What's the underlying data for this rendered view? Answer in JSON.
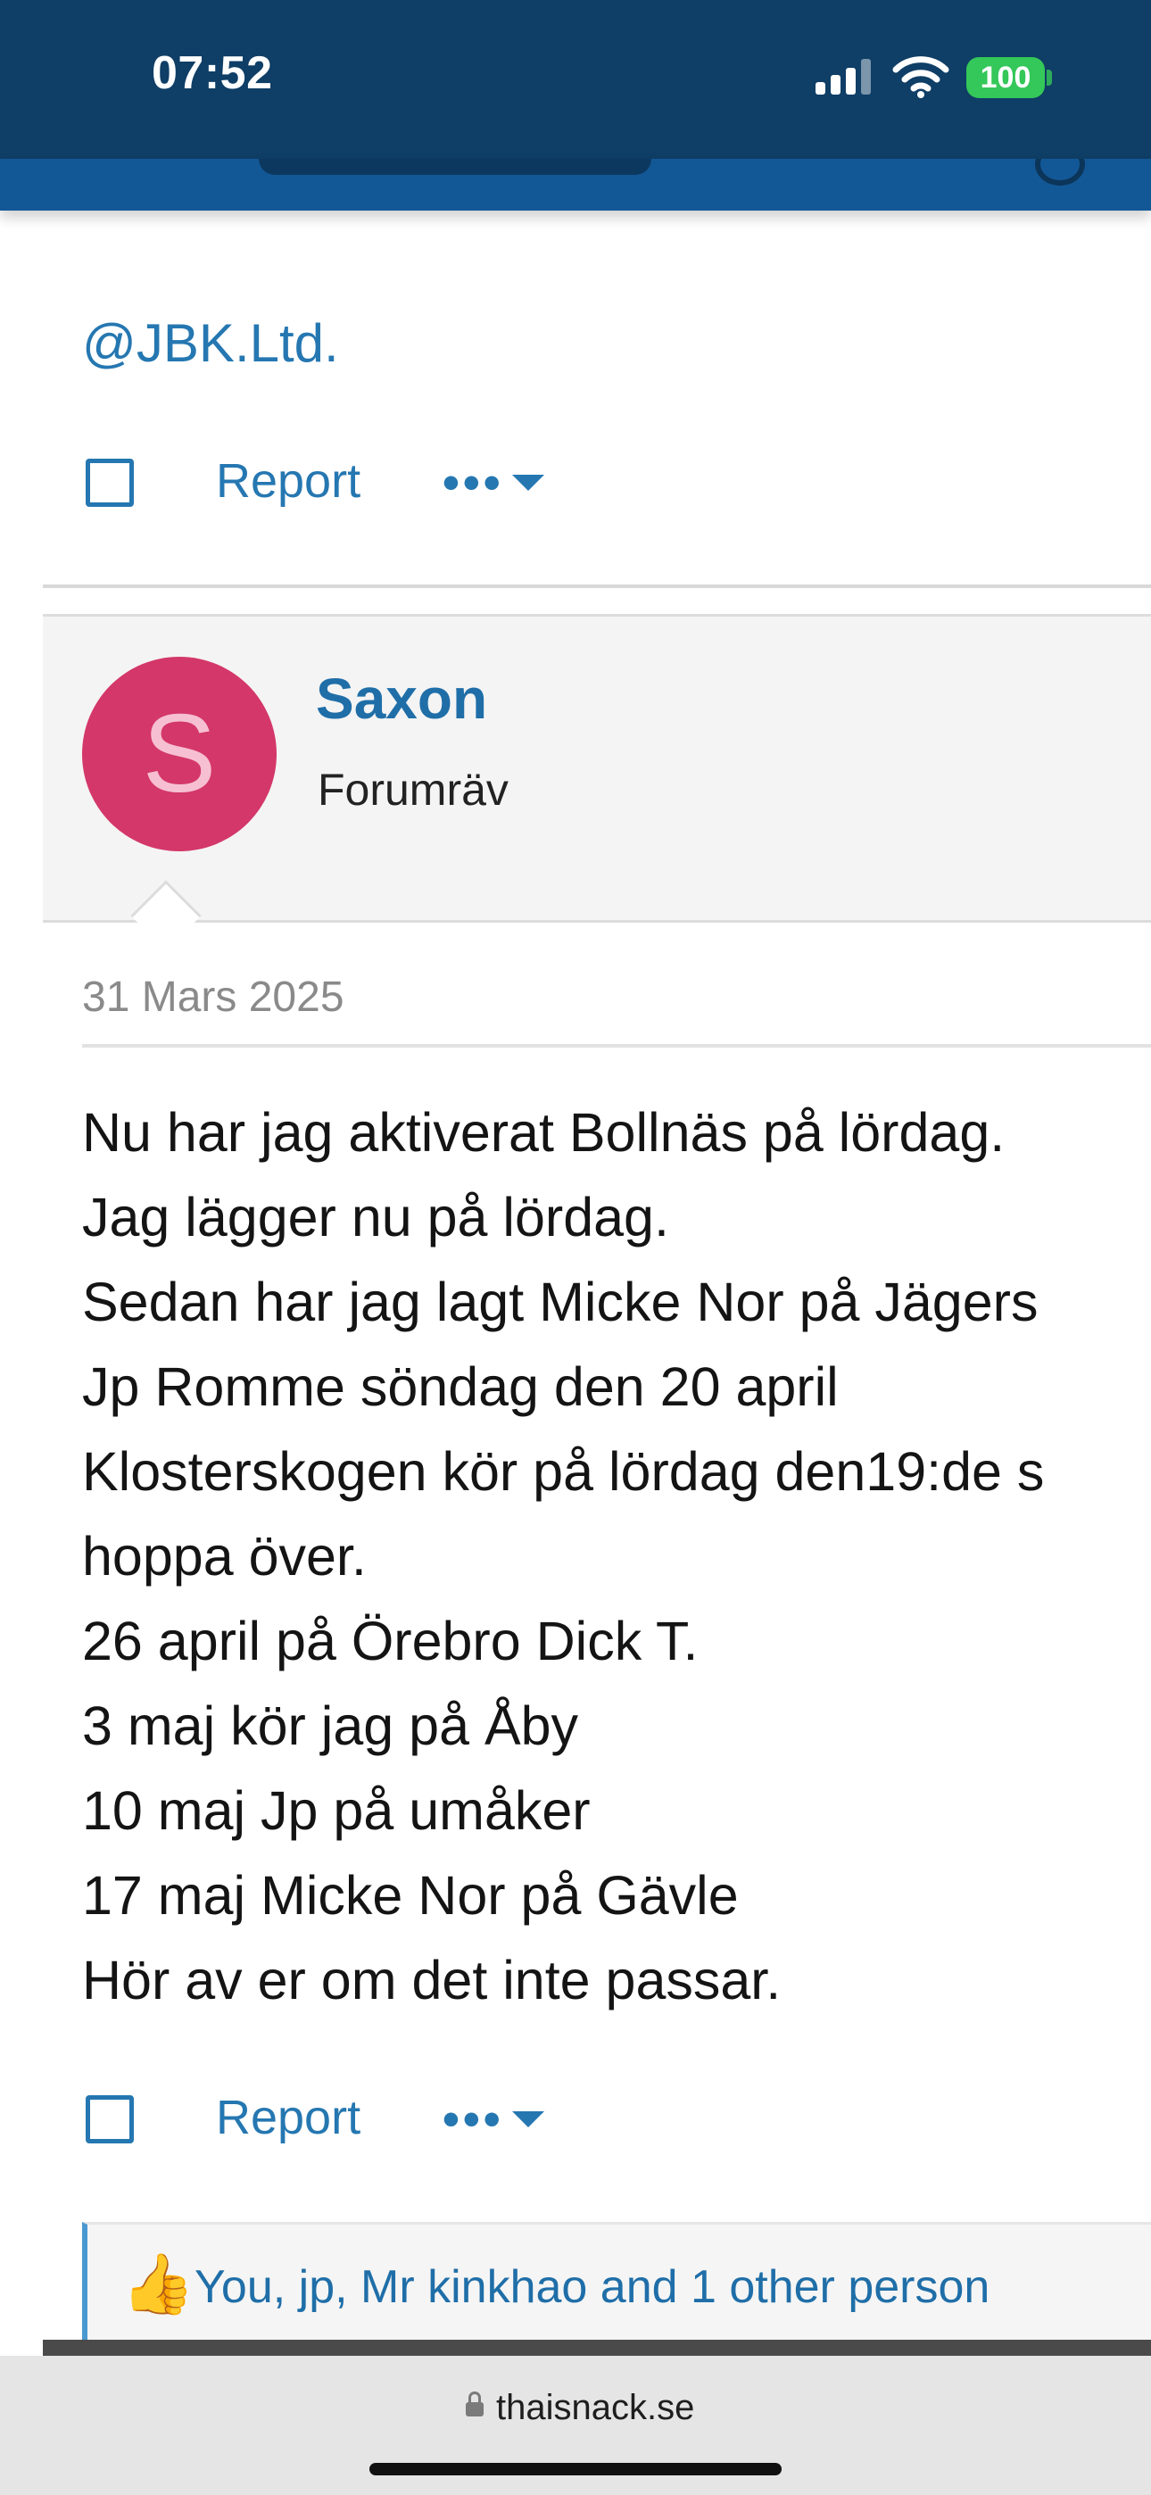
{
  "status_bar": {
    "time": "07:52",
    "battery": "100",
    "icons": [
      "signal-icon",
      "wifi-icon",
      "battery-icon"
    ]
  },
  "previous_post": {
    "mention": "@JBK.Ltd.",
    "report_label": "Report",
    "more_label": "•••"
  },
  "post": {
    "avatar_letter": "S",
    "username": "Saxon",
    "user_title": "Forumräv",
    "date": "31 Mars 2025",
    "body_lines": [
      "Nu har jag aktiverat Bollnäs på lördag.",
      "Jag lägger nu på lördag.",
      "Sedan har jag lagt Micke Nor på Jägers",
      "Jp Romme söndag den 20 april",
      "Klosterskogen kör på lördag den19:de s",
      "hoppa över.",
      "26 april på Örebro Dick T.",
      "3 maj kör jag på Åby",
      "10 maj Jp på umåker",
      "17 maj Micke Nor på Gävle",
      "Hör av er om det inte passar."
    ],
    "report_label": "Report",
    "more_label": "•••",
    "likes_text": "You, jp, Mr kinkhao and 1 other person",
    "like_icon": "👍"
  },
  "browser": {
    "url": "thaisnack.se"
  },
  "colors": {
    "status_bar_bg": "#0f3e66",
    "header_bg": "#135896",
    "link": "#2577b1",
    "avatar_bg": "#d4376a",
    "battery": "#34c759"
  }
}
